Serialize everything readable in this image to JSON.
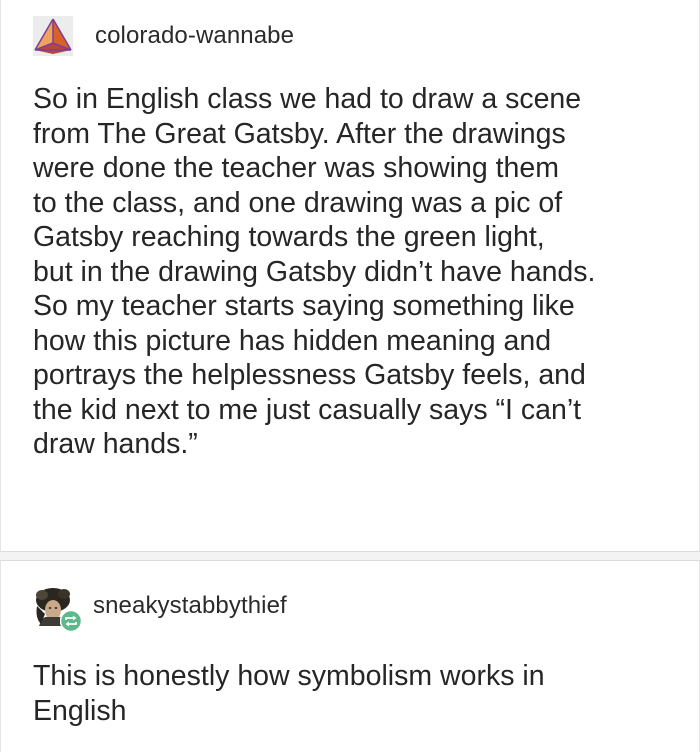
{
  "posts": [
    {
      "username": "colorado-wannabe",
      "avatar_icon": "pyramid-avatar-icon",
      "body_lines": [
        "So in English class we had to draw a scene",
        "from The Great Gatsby. After the drawings",
        "were done the teacher was showing them",
        "to the class, and one drawing was a pic of",
        "Gatsby reaching towards  the green light,",
        "but in the drawing Gatsby didn’t have hands.",
        "So my teacher starts saying something like",
        "how this picture has hidden meaning and",
        "portrays the helplessness Gatsby feels, and",
        "the kid next to me just casually says “I can’t",
        "draw hands.”"
      ]
    },
    {
      "username": "sneakystabbythief",
      "avatar_icon": "portrait-avatar-icon",
      "badge_icon": "reblog-icon",
      "body_lines": [
        "This is honestly how symbolism works in",
        "English"
      ]
    }
  ],
  "colors": {
    "page_background": "#f3f3f3",
    "post_background": "#ffffff",
    "text": "#262626",
    "reblog_badge": "#5fb88b",
    "avatar_orange": "#d9622b",
    "avatar_purple": "#7c3f95"
  }
}
